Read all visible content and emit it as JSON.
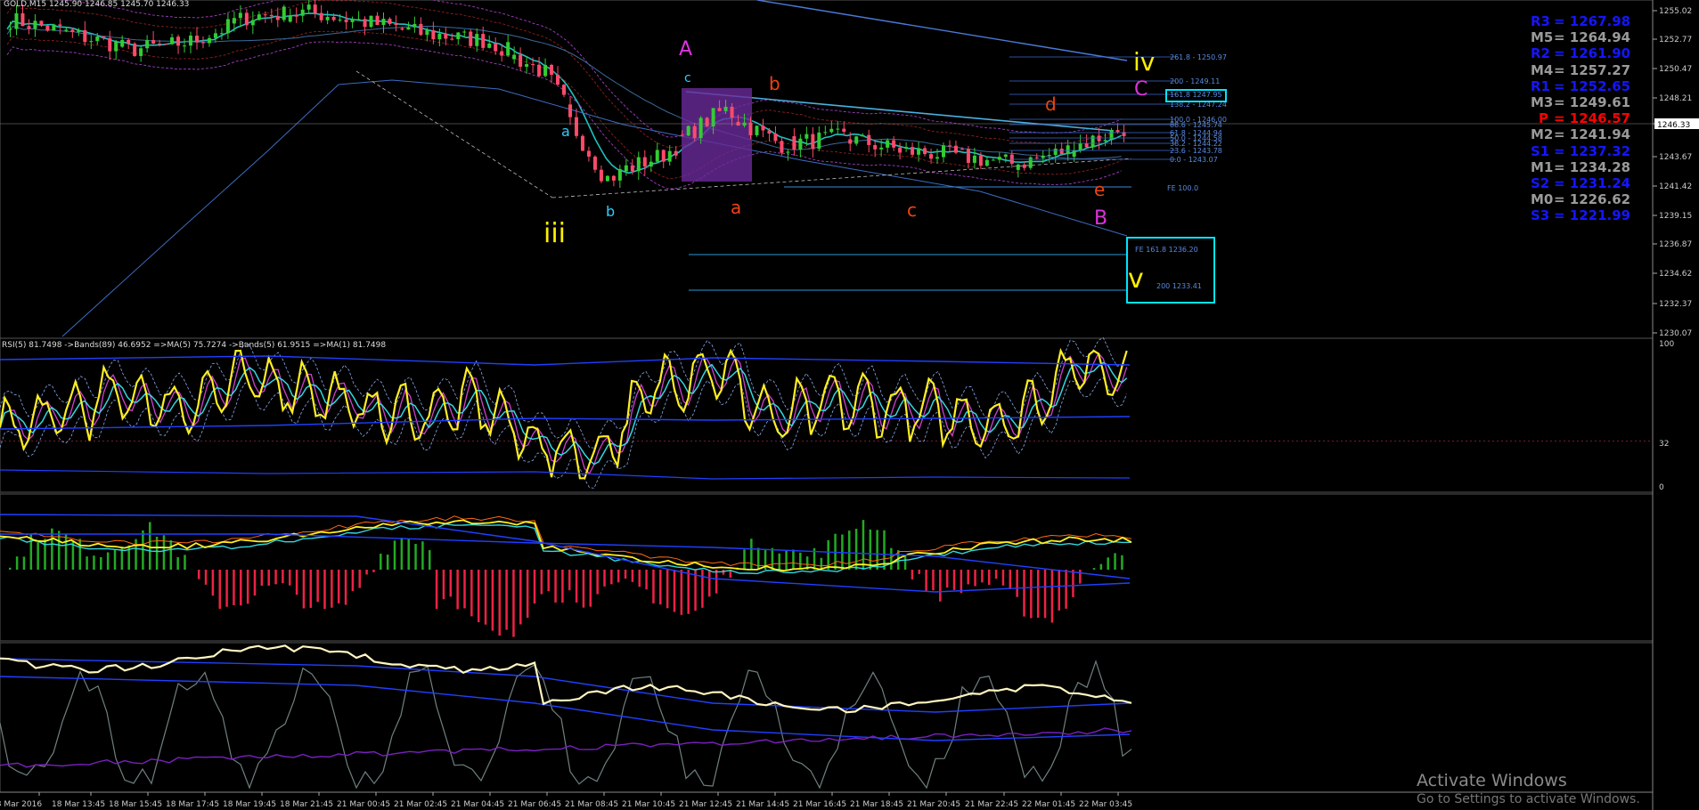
{
  "symbol_header": "GOLD,M15  1245.90 1246.85 1245.70 1246.33",
  "indicator_header": "RSI(5) 81.7498 ->Bands(89) 46.6952 =>MA(5) 75.7274 ->Bands(5) 61.9515 =>MA(1) 81.7498",
  "price_axis": [
    "1255.02",
    "1252.77",
    "1250.47",
    "1248.21",
    "1246.33",
    "1243.67",
    "1241.42",
    "1239.15",
    "1236.87",
    "1234.62",
    "1232.37",
    "1230.07"
  ],
  "current_price": "1246.33",
  "rsi_axis": [
    "100",
    "32",
    "0"
  ],
  "time_axis": [
    "18 Mar 2016",
    "18 Mar 13:45",
    "18 Mar 15:45",
    "18 Mar 17:45",
    "18 Mar 19:45",
    "18 Mar 21:45",
    "21 Mar 00:45",
    "21 Mar 02:45",
    "21 Mar 04:45",
    "21 Mar 06:45",
    "21 Mar 08:45",
    "21 Mar 10:45",
    "21 Mar 12:45",
    "21 Mar 14:45",
    "21 Mar 16:45",
    "21 Mar 18:45",
    "21 Mar 20:45",
    "21 Mar 22:45",
    "22 Mar 01:45",
    "22 Mar 03:45"
  ],
  "pivots": [
    {
      "label": "R3",
      "value": "1267.98",
      "color": "#1515ff"
    },
    {
      "label": "M5",
      "value": "1264.94",
      "color": "#9a9a9a"
    },
    {
      "label": "R2",
      "value": "1261.90",
      "color": "#1515ff"
    },
    {
      "label": "M4",
      "value": "1257.27",
      "color": "#9a9a9a"
    },
    {
      "label": "R1",
      "value": "1252.65",
      "color": "#1515ff"
    },
    {
      "label": "M3",
      "value": "1249.61",
      "color": "#9a9a9a"
    },
    {
      "label": "P",
      "value": "1246.57",
      "color": "#ff0000"
    },
    {
      "label": "M2",
      "value": "1241.94",
      "color": "#9a9a9a"
    },
    {
      "label": "S1",
      "value": "1237.32",
      "color": "#1515ff"
    },
    {
      "label": "M1",
      "value": "1234.28",
      "color": "#9a9a9a"
    },
    {
      "label": "S2",
      "value": "1231.24",
      "color": "#1515ff"
    },
    {
      "label": "M0",
      "value": "1226.62",
      "color": "#9a9a9a"
    },
    {
      "label": "S3",
      "value": "1221.99",
      "color": "#1515ff"
    }
  ],
  "fib_levels": [
    "261.8 - 1250.97",
    "200 - 1249.11",
    "161.8 1247.95",
    "138.2 - 1247.24",
    "100.0 - 1246.00",
    "88.6 - 1245.74",
    "61.8 - 1244.94",
    "50.0 - 1244.58",
    "38.2 - 1244.22",
    "23.6 - 1243.78",
    "0.0 - 1243.07"
  ],
  "fe_labels": [
    "FE 100.0",
    "FE 161.8 1236.20",
    "200 1233.41"
  ],
  "wave_labels": [
    {
      "text": "iii",
      "color": "#ffee00"
    },
    {
      "text": "a",
      "color": "#33ccff"
    },
    {
      "text": "b",
      "color": "#33ccff"
    },
    {
      "text": "A",
      "color": "#dd33dd"
    },
    {
      "text": "c",
      "color": "#33ccff"
    },
    {
      "text": "b",
      "color": "#ee4411"
    },
    {
      "text": "a",
      "color": "#ee4411"
    },
    {
      "text": "c",
      "color": "#ee4411"
    },
    {
      "text": "d",
      "color": "#ee4411"
    },
    {
      "text": "e",
      "color": "#ee4411"
    },
    {
      "text": "B",
      "color": "#dd33dd"
    },
    {
      "text": "iv",
      "color": "#ffee00"
    },
    {
      "text": "C",
      "color": "#dd33dd"
    },
    {
      "text": "v",
      "color": "#ffee00"
    }
  ],
  "watermark": {
    "title": "Activate Windows",
    "subtitle": "Go to Settings to activate Windows."
  },
  "chart_data": {
    "type": "line",
    "title": "GOLD,M15",
    "x": [
      "18 Mar 2016",
      "18 Mar 13:45",
      "18 Mar 15:45",
      "18 Mar 17:45",
      "18 Mar 19:45",
      "18 Mar 21:45",
      "21 Mar 00:45",
      "21 Mar 02:45",
      "21 Mar 04:45",
      "21 Mar 06:45",
      "21 Mar 08:45",
      "21 Mar 10:45",
      "21 Mar 12:45",
      "21 Mar 14:45",
      "21 Mar 16:45",
      "21 Mar 18:45",
      "21 Mar 20:45",
      "21 Mar 22:45",
      "22 Mar 01:45",
      "22 Mar 03:45"
    ],
    "series": [
      {
        "name": "GOLD,M15",
        "values": [
          1254.3,
          1253.2,
          1252.0,
          1252.6,
          1254.6,
          1254.9,
          1254.1,
          1253.2,
          1252.7,
          1250.2,
          1242.0,
          1243.9,
          1247.4,
          1244.6,
          1245.3,
          1244.2,
          1243.8,
          1243.1,
          1244.5,
          1246.33
        ]
      },
      {
        "name": "RSI(5)",
        "values": [
          40,
          50,
          65,
          55,
          75,
          70,
          55,
          50,
          60,
          30,
          20,
          70,
          85,
          45,
          60,
          55,
          50,
          45,
          85,
          81.75
        ]
      }
    ],
    "ylim": [
      1230.07,
      1255.02
    ],
    "rsi_ylim": [
      0,
      100
    ],
    "grid": false,
    "legend": "none"
  }
}
